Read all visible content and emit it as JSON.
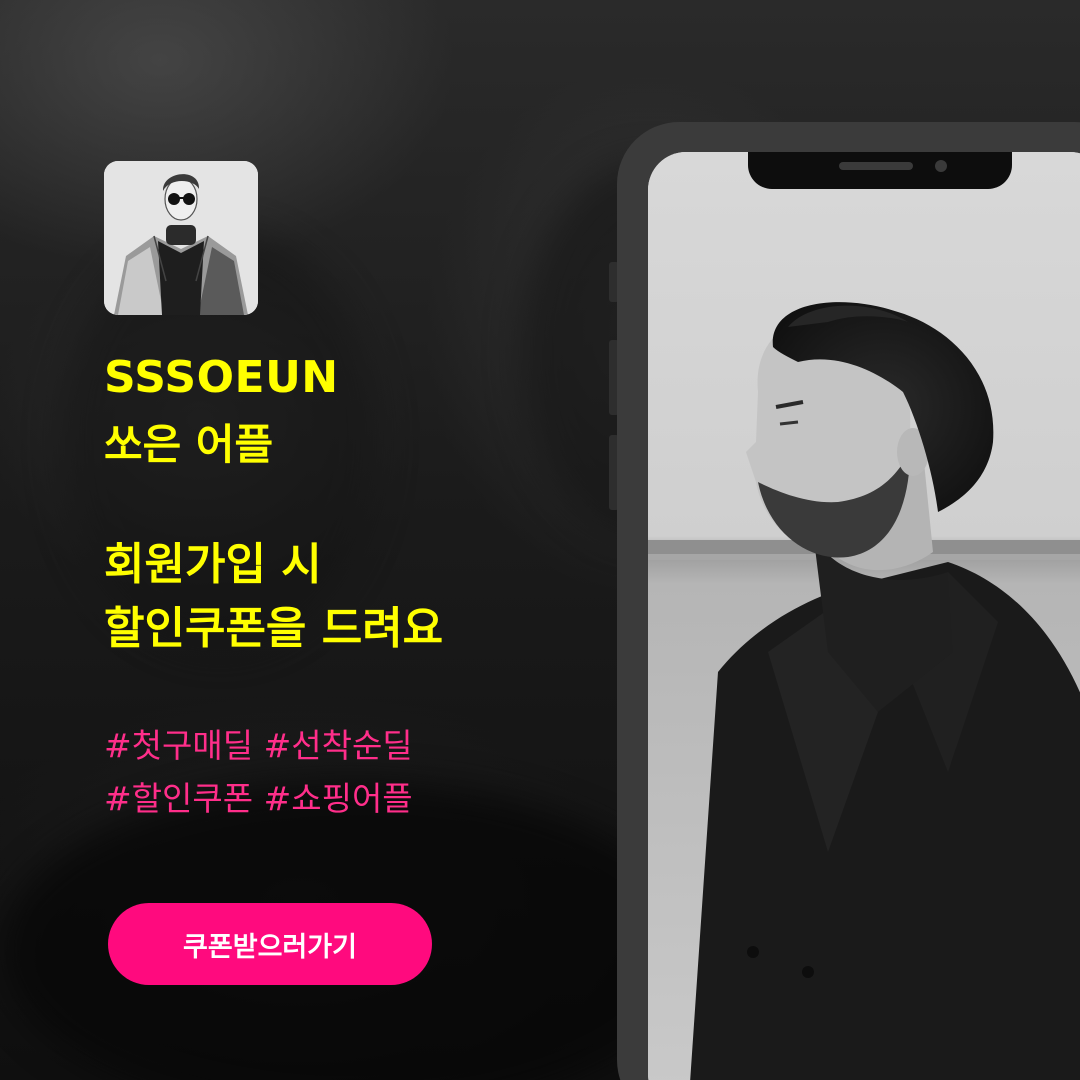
{
  "brand": {
    "name": "SSSOEUN",
    "subtitle": "쏘은 어플"
  },
  "headline": {
    "line1": "회원가입 시",
    "line2": "할인쿠폰을 드려요"
  },
  "hashtags": {
    "line1": "#첫구매딜 #선착순딜",
    "line2": "#할인쿠폰 #쇼핑어플"
  },
  "cta": {
    "label": "쿠폰받으러가기"
  },
  "icons": {
    "avatar": "fashion-illustration-avatar",
    "phone_photo": "man-in-black-coat-photo"
  },
  "colors": {
    "brand_yellow": "#ffff00",
    "hashtag_pink": "#ff2e8a",
    "cta_pink": "#ff0a7e",
    "background": "#0d0d0d"
  }
}
